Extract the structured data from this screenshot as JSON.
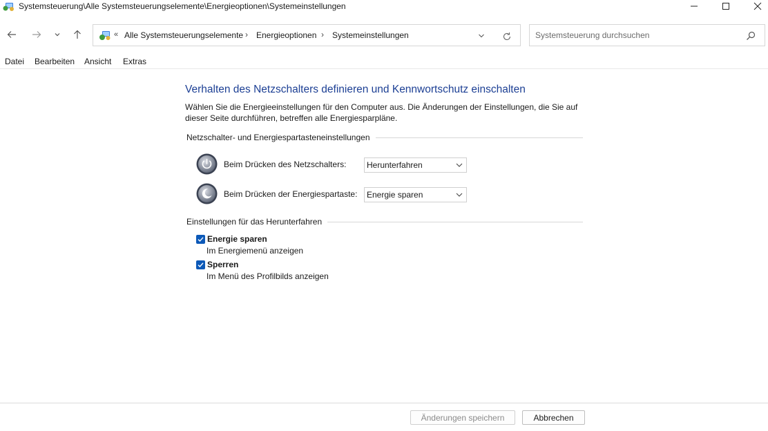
{
  "window": {
    "title": "Systemsteuerung\\Alle Systemsteuerungselemente\\Energieoptionen\\Systemeinstellungen",
    "icon": "control-panel-icon"
  },
  "address_bar": {
    "overflow": "«",
    "breadcrumbs": [
      "Alle Systemsteuerungselemente",
      "Energieoptionen",
      "Systemeinstellungen"
    ],
    "separator": "›"
  },
  "search": {
    "placeholder": "Systemsteuerung durchsuchen"
  },
  "menu": [
    "Datei",
    "Bearbeiten",
    "Ansicht",
    "Extras"
  ],
  "page": {
    "title": "Verhalten des Netzschalters definieren und Kennwortschutz einschalten",
    "description": "Wählen Sie die Energieeinstellungen für den Computer aus. Die Änderungen der Einstellungen, die Sie auf dieser Seite durchführen, betreffen alle Energiesparpläne."
  },
  "power_section": {
    "header": "Netzschalter- und Energiespartasteneinstellungen",
    "rows": [
      {
        "label": "Beim Drücken des Netzschalters:",
        "value": "Herunterfahren",
        "icon": "power-button-icon"
      },
      {
        "label": "Beim Drücken der Energiespartaste:",
        "value": "Energie sparen",
        "icon": "sleep-button-icon"
      }
    ]
  },
  "shutdown_section": {
    "header": "Einstellungen für das Herunterfahren",
    "items": [
      {
        "label": "Energie sparen",
        "description": "Im Energiemenü anzeigen",
        "checked": true
      },
      {
        "label": "Sperren",
        "description": "Im Menü des Profilbilds anzeigen",
        "checked": true
      }
    ]
  },
  "footer": {
    "save_label": "Änderungen speichern",
    "cancel_label": "Abbrechen",
    "save_enabled": false
  },
  "colors": {
    "accent": "#0c59b8",
    "title": "#1c3f94"
  }
}
